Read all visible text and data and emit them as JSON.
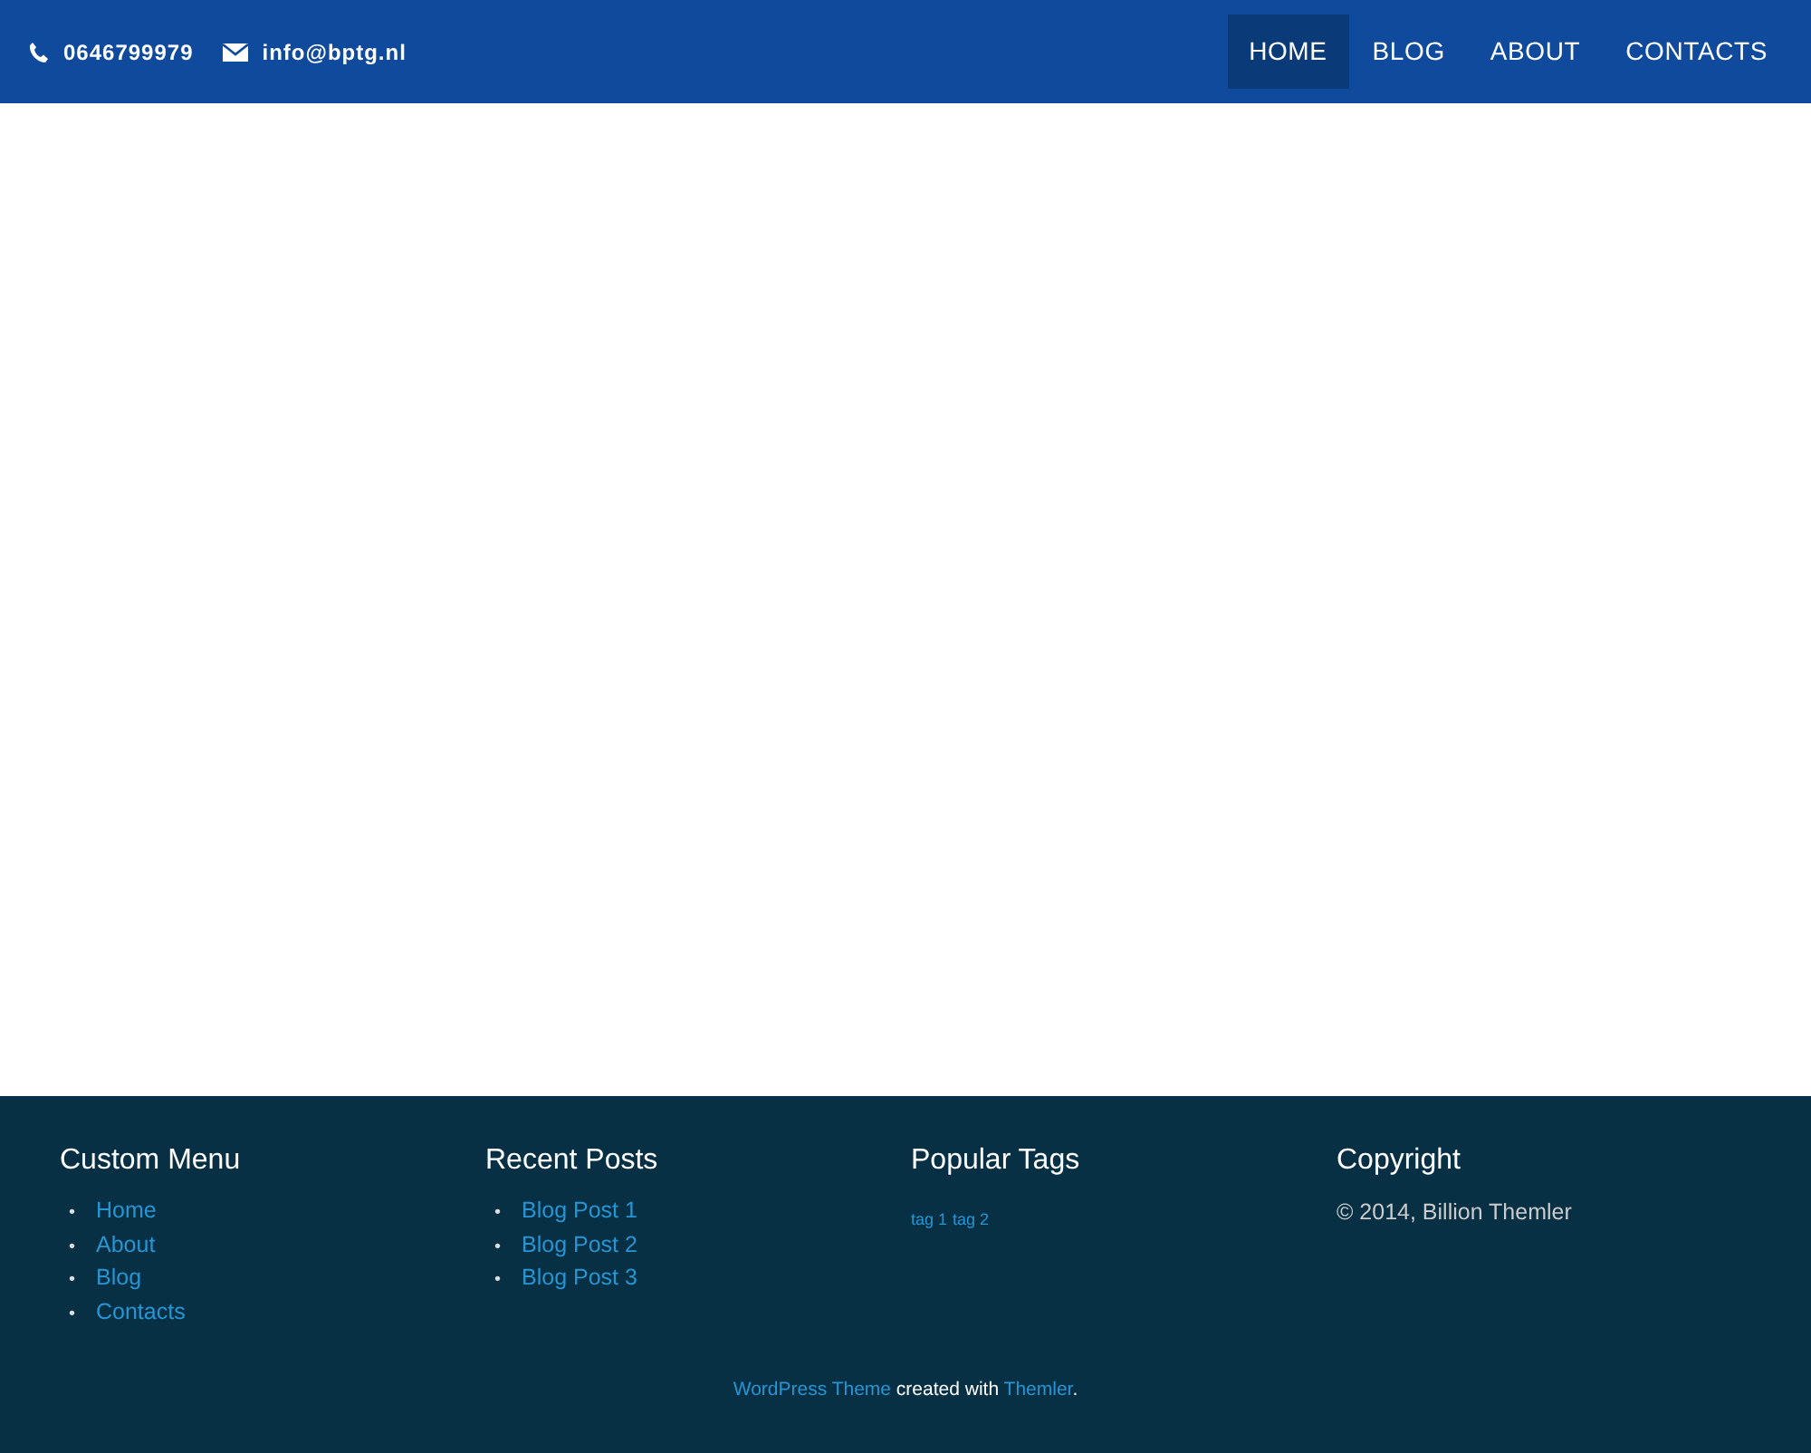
{
  "header": {
    "phone": "0646799979",
    "email": "info@bptg.nl",
    "nav": [
      {
        "label": "HOME",
        "selected": true
      },
      {
        "label": "BLOG",
        "selected": false
      },
      {
        "label": "ABOUT",
        "selected": false
      },
      {
        "label": "CONTACTS",
        "selected": false
      }
    ]
  },
  "footer": {
    "widgets": [
      {
        "kind": "list",
        "title": "Custom Menu",
        "bullet": "•",
        "items": [
          "Home",
          "About",
          "Blog",
          "Contacts"
        ]
      },
      {
        "kind": "list",
        "title": "Recent Posts",
        "bullet": "•",
        "items": [
          "Blog Post 1",
          "Blog Post 2",
          "Blog Post 3"
        ]
      },
      {
        "kind": "tags",
        "title": "Popular Tags",
        "items": [
          "tag 1",
          "tag 2"
        ]
      },
      {
        "kind": "text",
        "title": "Copyright",
        "text": "© 2014, Billion Themler"
      }
    ],
    "credit": {
      "link_1": "WordPress Theme",
      "middle": "created with",
      "link_2": "Themler",
      "end": "."
    }
  }
}
